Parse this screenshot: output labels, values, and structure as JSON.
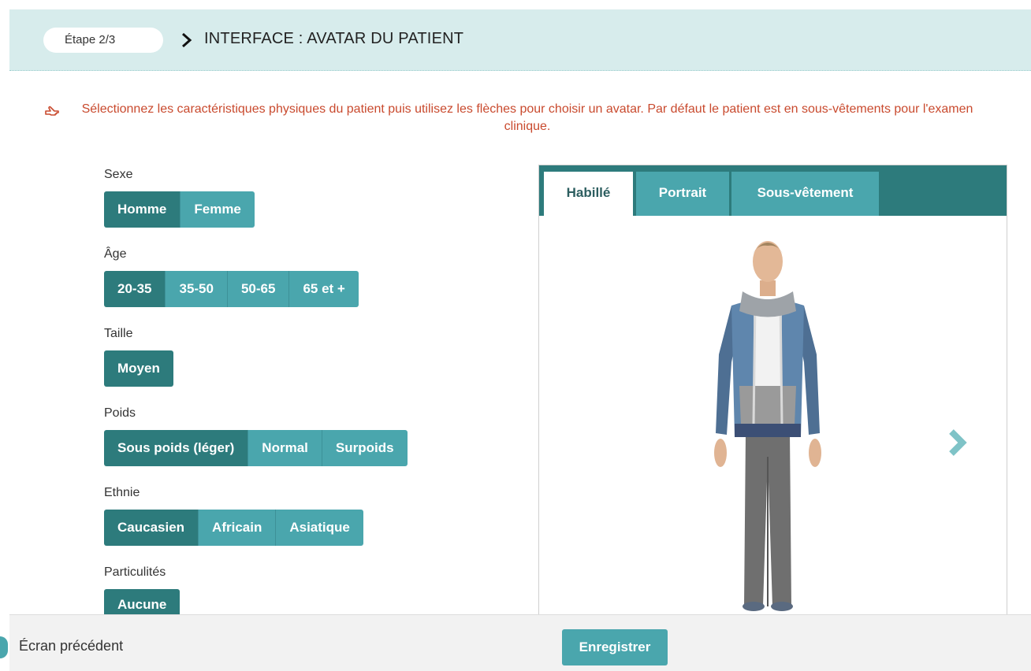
{
  "header": {
    "step": "Étape 2/3",
    "title": "INTERFACE : AVATAR DU PATIENT"
  },
  "instruction": "Sélectionnez les caractéristiques physiques du patient puis utilisez les flèches pour choisir un avatar. Par défaut le patient est en sous-vêtements pour l'examen clinique.",
  "groups": {
    "sexe": {
      "label": "Sexe",
      "options": [
        "Homme",
        "Femme"
      ],
      "selected": "Homme"
    },
    "age": {
      "label": "Âge",
      "options": [
        "20-35",
        "35-50",
        "50-65",
        "65 et +"
      ],
      "selected": "20-35"
    },
    "taille": {
      "label": "Taille",
      "options": [
        "Moyen"
      ],
      "selected": "Moyen"
    },
    "poids": {
      "label": "Poids",
      "options": [
        "Sous poids (léger)",
        "Normal",
        "Surpoids"
      ],
      "selected": "Sous poids (léger)"
    },
    "ethnie": {
      "label": "Ethnie",
      "options": [
        "Caucasien",
        "Africain",
        "Asiatique"
      ],
      "selected": "Caucasien"
    },
    "particularites": {
      "label": "Particulités",
      "options": [
        "Aucune"
      ],
      "selected": "Aucune"
    }
  },
  "viewer": {
    "tabs": [
      "Habillé",
      "Portrait",
      "Sous-vêtement"
    ],
    "active_tab": "Habillé",
    "next_icon": "chevron-right-icon"
  },
  "footer": {
    "prev_label": "Écran précédent",
    "save_label": "Enregistrer"
  },
  "colors": {
    "header_bg": "#d7ecec",
    "accent": "#4aa6ad",
    "accent_dark": "#2d7b7c",
    "instruction": "#c94a2e"
  }
}
